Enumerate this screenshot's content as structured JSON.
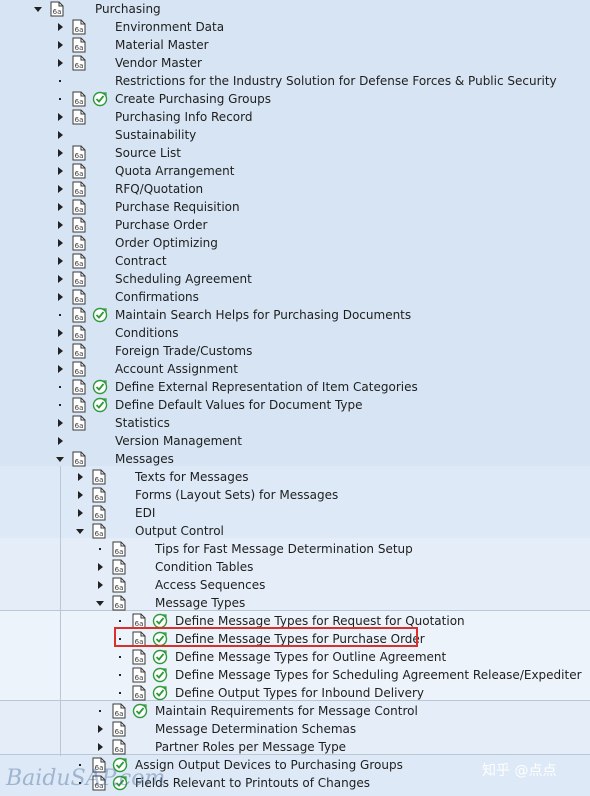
{
  "tree": [
    {
      "label": "Purchasing",
      "level": 0,
      "exp": "down",
      "doc": true,
      "exe": false
    },
    {
      "label": "Environment Data",
      "level": 1,
      "exp": "right",
      "doc": true,
      "exe": false
    },
    {
      "label": "Material Master",
      "level": 1,
      "exp": "right",
      "doc": true,
      "exe": false
    },
    {
      "label": "Vendor Master",
      "level": 1,
      "exp": "right",
      "doc": true,
      "exe": false
    },
    {
      "label": "Restrictions for the Industry Solution for Defense Forces & Public Security",
      "level": 1,
      "exp": "dot",
      "doc": false,
      "exe": false
    },
    {
      "label": "Create Purchasing Groups",
      "level": 1,
      "exp": "dot",
      "doc": true,
      "exe": true
    },
    {
      "label": "Purchasing Info Record",
      "level": 1,
      "exp": "right",
      "doc": true,
      "exe": false
    },
    {
      "label": "Sustainability",
      "level": 1,
      "exp": "right",
      "doc": false,
      "exe": false
    },
    {
      "label": "Source List",
      "level": 1,
      "exp": "right",
      "doc": true,
      "exe": false
    },
    {
      "label": "Quota Arrangement",
      "level": 1,
      "exp": "right",
      "doc": true,
      "exe": false
    },
    {
      "label": "RFQ/Quotation",
      "level": 1,
      "exp": "right",
      "doc": true,
      "exe": false
    },
    {
      "label": "Purchase Requisition",
      "level": 1,
      "exp": "right",
      "doc": true,
      "exe": false
    },
    {
      "label": "Purchase Order",
      "level": 1,
      "exp": "right",
      "doc": true,
      "exe": false
    },
    {
      "label": "Order Optimizing",
      "level": 1,
      "exp": "right",
      "doc": true,
      "exe": false
    },
    {
      "label": "Contract",
      "level": 1,
      "exp": "right",
      "doc": true,
      "exe": false
    },
    {
      "label": "Scheduling Agreement",
      "level": 1,
      "exp": "right",
      "doc": true,
      "exe": false
    },
    {
      "label": "Confirmations",
      "level": 1,
      "exp": "right",
      "doc": true,
      "exe": false
    },
    {
      "label": "Maintain Search Helps for Purchasing Documents",
      "level": 1,
      "exp": "dot",
      "doc": true,
      "exe": true
    },
    {
      "label": "Conditions",
      "level": 1,
      "exp": "right",
      "doc": true,
      "exe": false
    },
    {
      "label": "Foreign Trade/Customs",
      "level": 1,
      "exp": "right",
      "doc": true,
      "exe": false
    },
    {
      "label": "Account Assignment",
      "level": 1,
      "exp": "right",
      "doc": true,
      "exe": false
    },
    {
      "label": "Define External Representation of Item Categories",
      "level": 1,
      "exp": "dot",
      "doc": true,
      "exe": true
    },
    {
      "label": "Define Default Values for Document Type",
      "level": 1,
      "exp": "dot",
      "doc": true,
      "exe": true
    },
    {
      "label": "Statistics",
      "level": 1,
      "exp": "right",
      "doc": true,
      "exe": false
    },
    {
      "label": "Version Management",
      "level": 1,
      "exp": "right",
      "doc": false,
      "exe": false
    },
    {
      "label": "Messages",
      "level": 1,
      "exp": "down",
      "doc": true,
      "exe": false
    },
    {
      "label": "Texts for Messages",
      "level": 2,
      "exp": "right",
      "doc": true,
      "exe": false
    },
    {
      "label": "Forms (Layout Sets) for Messages",
      "level": 2,
      "exp": "right",
      "doc": true,
      "exe": false
    },
    {
      "label": "EDI",
      "level": 2,
      "exp": "right",
      "doc": true,
      "exe": false
    },
    {
      "label": "Output Control",
      "level": 2,
      "exp": "down",
      "doc": true,
      "exe": false
    },
    {
      "label": "Tips for Fast Message Determination Setup",
      "level": 3,
      "exp": "dot",
      "doc": true,
      "exe": false
    },
    {
      "label": "Condition Tables",
      "level": 3,
      "exp": "right",
      "doc": true,
      "exe": false
    },
    {
      "label": "Access Sequences",
      "level": 3,
      "exp": "right",
      "doc": true,
      "exe": false
    },
    {
      "label": "Message Types",
      "level": 3,
      "exp": "down",
      "doc": true,
      "exe": false
    },
    {
      "label": "Define Message Types for Request for Quotation",
      "level": 4,
      "exp": "dot",
      "doc": true,
      "exe": true
    },
    {
      "label": "Define Message Types for Purchase Order",
      "level": 4,
      "exp": "dot",
      "doc": true,
      "exe": true
    },
    {
      "label": "Define Message Types for Outline Agreement",
      "level": 4,
      "exp": "dot",
      "doc": true,
      "exe": true
    },
    {
      "label": "Define Message Types for Scheduling Agreement Release/Expediter",
      "level": 4,
      "exp": "dot",
      "doc": true,
      "exe": true
    },
    {
      "label": "Define Output Types for Inbound Delivery",
      "level": 4,
      "exp": "dot",
      "doc": true,
      "exe": true
    },
    {
      "label": "Maintain Requirements for Message Control",
      "level": 3,
      "exp": "dot",
      "doc": true,
      "exe": true
    },
    {
      "label": "Message Determination Schemas",
      "level": 3,
      "exp": "right",
      "doc": true,
      "exe": false
    },
    {
      "label": "Partner Roles per Message Type",
      "level": 3,
      "exp": "right",
      "doc": true,
      "exe": false
    },
    {
      "label": "Assign Output Devices to Purchasing Groups",
      "level": 2,
      "exp": "dot",
      "doc": true,
      "exe": true
    },
    {
      "label": "Fields Relevant to Printouts of Changes",
      "level": 2,
      "exp": "dot",
      "doc": true,
      "exe": true
    }
  ],
  "highlighted_item": "Define Message Types for Purchase Order",
  "watermark_left": "BaiduSAP.com",
  "watermark_right": "知乎 @点点",
  "colors": {
    "highlight_border": "#d9302b",
    "execute_icon": "#2e9a3a",
    "background": "#d6e4f3"
  }
}
